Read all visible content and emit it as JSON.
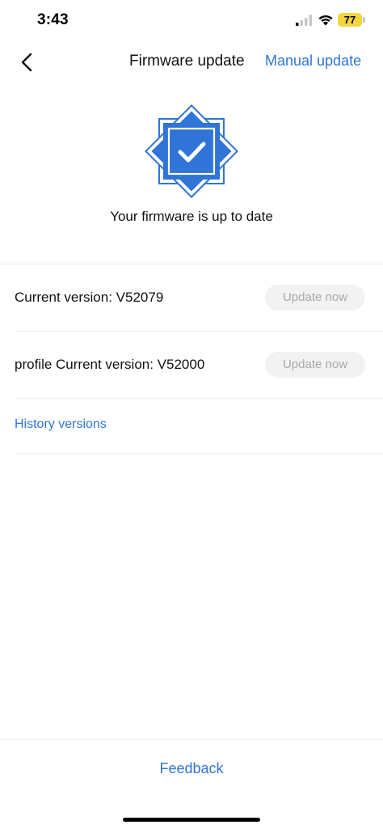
{
  "status_bar": {
    "time": "3:43",
    "battery": "77",
    "battery_color": "#f5d53b"
  },
  "nav": {
    "title": "Firmware update",
    "manual_update": "Manual update"
  },
  "hero": {
    "icon": "verified-check-icon",
    "message": "Your firmware is up to date",
    "accent": "#2f74d6"
  },
  "rows": [
    {
      "label": "Current version: V52079",
      "button": "Update now"
    },
    {
      "label": "profile Current version: V52000",
      "button": "Update now"
    }
  ],
  "history_link": "History versions",
  "footer": {
    "feedback": "Feedback"
  }
}
